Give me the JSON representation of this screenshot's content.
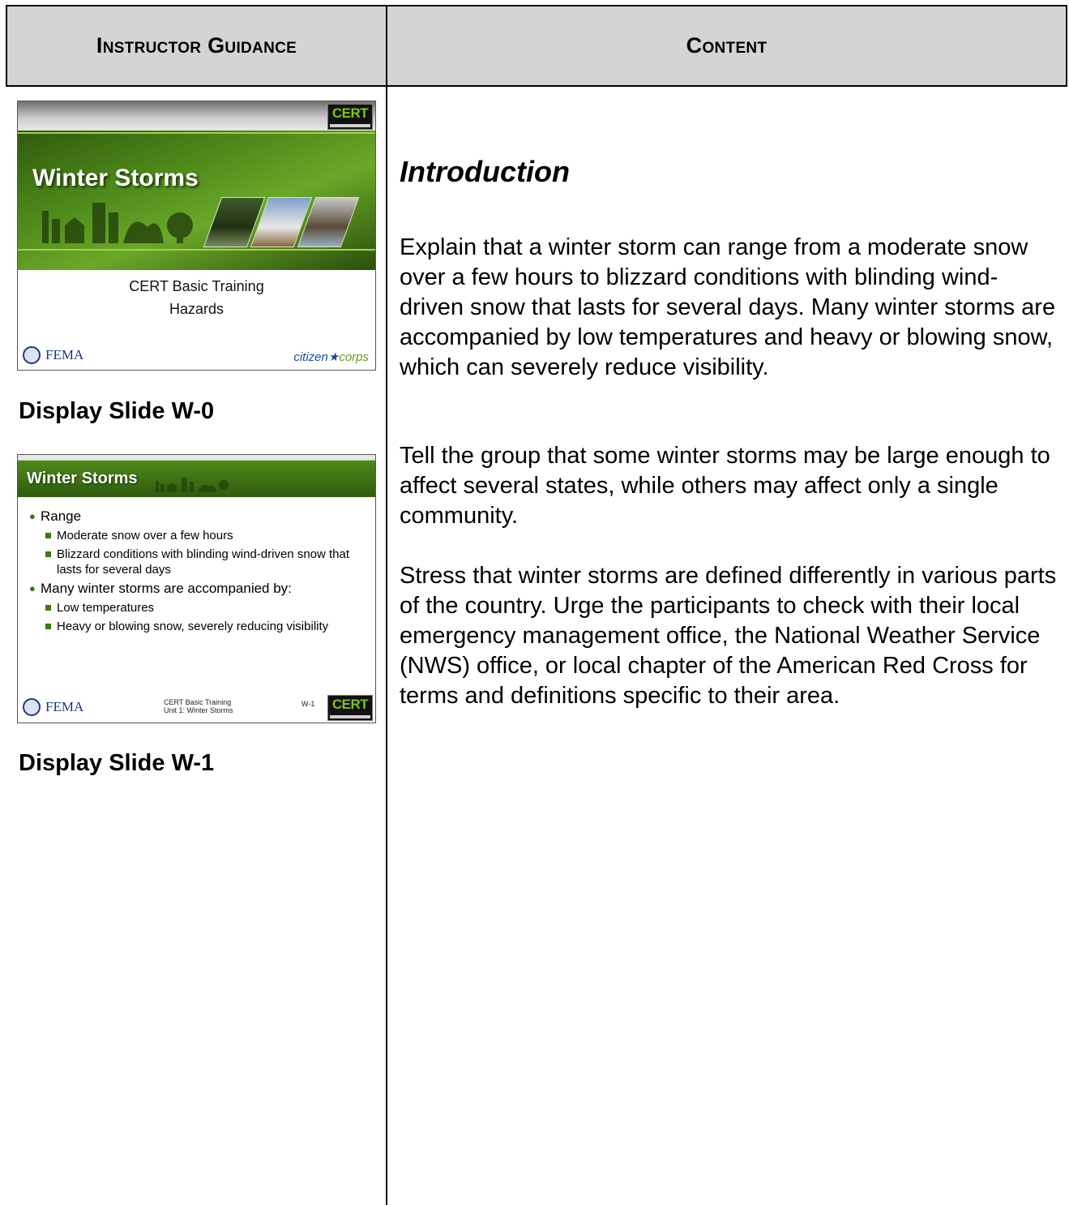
{
  "header": {
    "left": "Instructor Guidance",
    "right": "Content"
  },
  "slide0": {
    "title": "Winter Storms",
    "subtitle_line1": "CERT Basic Training",
    "subtitle_line2": "Hazards",
    "fema_label": "FEMA",
    "citizen_corps": "citizen",
    "citizen_corps2": "corps",
    "cert_logo": "CERT"
  },
  "slide0_label": "Display Slide W-0",
  "slide1": {
    "title": "Winter Storms",
    "bullets": [
      {
        "text": "Range",
        "sub": [
          "Moderate snow over a few hours",
          "Blizzard conditions with blinding wind-driven snow that lasts for several days"
        ]
      },
      {
        "text": "Many winter storms are accompanied by:",
        "sub": [
          "Low temperatures",
          "Heavy or blowing snow, severely reducing visibility"
        ]
      }
    ],
    "footer_line1": "CERT Basic Training",
    "footer_line2": "Unit 1: Winter Storms",
    "slide_number": "W-1",
    "fema_label": "FEMA",
    "cert_logo": "CERT"
  },
  "slide1_label": "Display Slide W-1",
  "content": {
    "heading": "Introduction",
    "paragraphs": [
      "Explain that a winter storm can range from a moderate snow over a few hours to blizzard conditions with blinding wind-driven snow that lasts for several days. Many winter storms are accompanied by low temperatures and heavy or blowing snow, which can severely reduce visibility.",
      "Tell the group that some winter storms may be large enough to affect several states, while others may affect only a single community.",
      "Stress that winter storms are defined differently in various parts of the country.  Urge the participants to check with their local emergency management office, the National Weather Service (NWS) office, or local chapter of the American Red Cross for terms and definitions specific to their area."
    ]
  }
}
